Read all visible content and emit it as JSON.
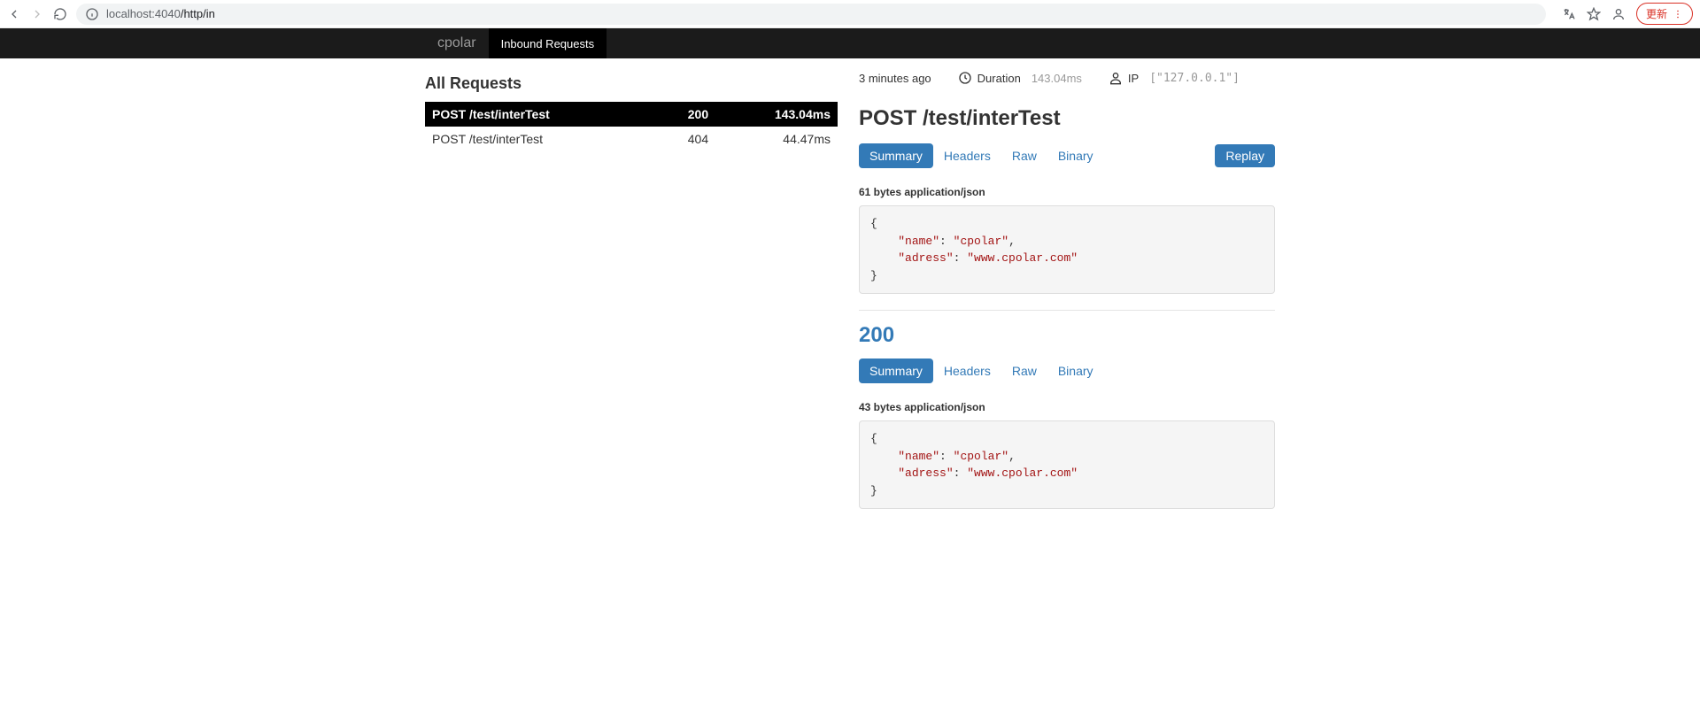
{
  "browser": {
    "url_host": "localhost:4040",
    "url_path": "/http/in",
    "update_label": "更新"
  },
  "nav": {
    "brand": "cpolar",
    "tab_inbound": "Inbound Requests"
  },
  "left": {
    "title": "All Requests",
    "rows": [
      {
        "line": "POST /test/interTest",
        "status": "200",
        "time": "143.04ms",
        "selected": true
      },
      {
        "line": "POST /test/interTest",
        "status": "404",
        "time": "44.47ms",
        "selected": false
      }
    ]
  },
  "right": {
    "meta": {
      "age": "3 minutes ago",
      "duration_label": "Duration",
      "duration_value": "143.04ms",
      "ip_label": "IP",
      "ip_value": "[\"127.0.0.1\"]"
    },
    "title": "POST /test/interTest",
    "tabs": {
      "summary": "Summary",
      "headers": "Headers",
      "raw": "Raw",
      "binary": "Binary"
    },
    "replay_label": "Replay",
    "request": {
      "bytes_line": "61 bytes application/json",
      "json": {
        "k1": "\"name\"",
        "v1": "\"cpolar\"",
        "k2": "\"adress\"",
        "v2": "\"www.cpolar.com\""
      }
    },
    "response": {
      "status_code": "200",
      "tabs": {
        "summary": "Summary",
        "headers": "Headers",
        "raw": "Raw",
        "binary": "Binary"
      },
      "bytes_line": "43 bytes application/json",
      "json": {
        "k1": "\"name\"",
        "v1": "\"cpolar\"",
        "k2": "\"adress\"",
        "v2": "\"www.cpolar.com\""
      }
    }
  }
}
